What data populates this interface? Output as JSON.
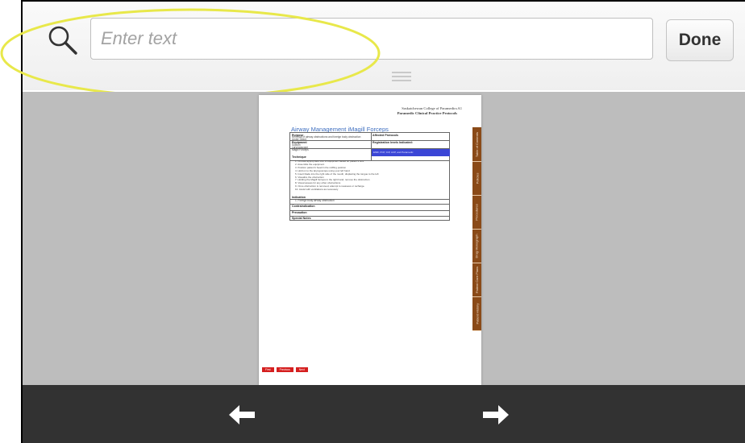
{
  "search": {
    "placeholder": "Enter text",
    "done_label": "Done"
  },
  "document": {
    "header_line1": "Saskatchewan College of Paramedics",
    "header_line2": "Paramedic Clinical Practice Protocols",
    "page_number": "A1",
    "title": "Airway Management iMagill Forceps",
    "table": {
      "purpose_label": "Purpose",
      "purpose_text": "Removal of airway obstructions and foreign body obstruction",
      "purpose_text2": "Under Direct",
      "affected_label": "Affected Protocols",
      "equipment_label": "Equipment",
      "equipment_items": [
        "Suction",
        "Laryngoscope",
        "Magill Forceps"
      ],
      "registration_label": "Registration levels Indicated:",
      "registration_value": "EMR, PCP, ICP, ACP, and Paramedic",
      "technique_label": "Technique",
      "steps": [
        "1.   Choose appropriate size of equipment based on patient's size",
        "2.   Assemble the equipment",
        "3.   Position patient's head in the sniffing position",
        "4.   Hold on to the laryngoscope using your left hand",
        "5.   Insert blade into the right side of the mouth, displacing the tongue to the left",
        "6.   Visualize the obstruction",
        "7.   Holding the Magill forceps in the right hand, remove the obstruction",
        "8.   Visual assess for any other obstructions",
        "9.   Once obstruction is removed, attempt to reassess or recharge.",
        "10.  Assist with ventilations as necessary"
      ],
      "indication_label": "Indication",
      "indication_text": "1.   Foreign body airway obstruction",
      "contraindication_label": "Contraindication",
      "precaution_label": "Precaution",
      "special_notes_label": "Special Notes"
    },
    "side_tabs": [
      "Table of Contents",
      "Policies",
      "Procedures",
      "Drug Monograph",
      "Patient Care Plans",
      "Patient History"
    ],
    "nav": [
      "First",
      "Previous",
      "Next"
    ]
  },
  "colors": {
    "highlight_ellipse": "#e8e84a",
    "blue_cell": "#3b46d6",
    "side_tab": "#8a4a18",
    "nav_button": "#d51f1f",
    "bottom_bar": "#323232",
    "viewer_bg": "#bdbdbd"
  },
  "icons": {
    "search": "magnifier-icon",
    "previous": "arrow-left-icon",
    "next": "arrow-right-icon"
  }
}
